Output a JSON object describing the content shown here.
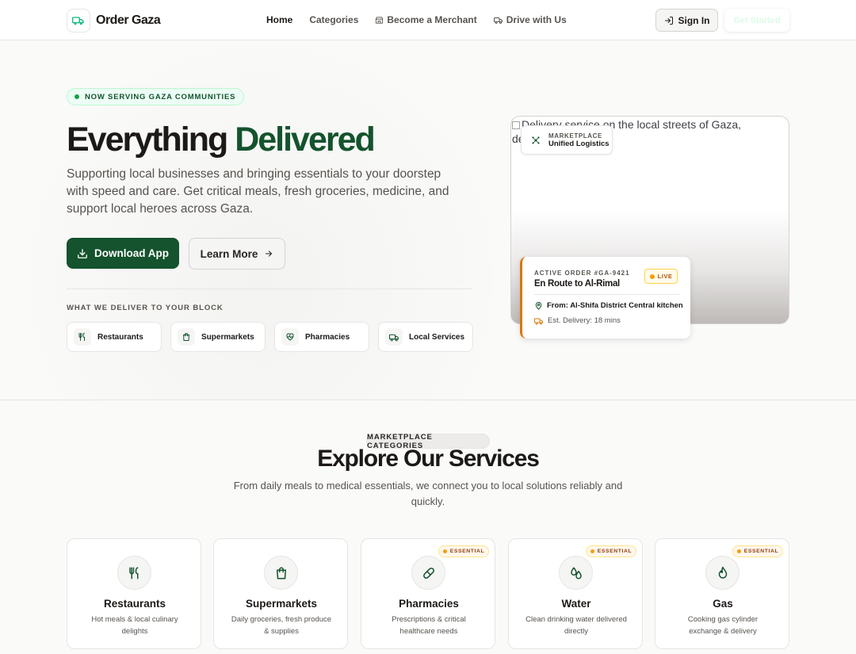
{
  "nav": {
    "logo_text": "Order Gaza",
    "links": [
      "Home",
      "Categories",
      "Become a Merchant",
      "Drive with Us"
    ],
    "sign_in": "Sign In",
    "get_started": "Get Started"
  },
  "hero": {
    "badge": "NOW SERVING GAZA COMMUNITIES",
    "title_part1": "Everything",
    "title_part2": "Delivered",
    "description": "Supporting local businesses and bringing essentials to your doorstep with speed and care. Get critical meals, fresh groceries, medicine, and support local heroes across Gaza.",
    "download_btn": "Download App",
    "learn_btn": "Learn More",
    "deliver_label": "WHAT WE DELIVER TO YOUR BLOCK",
    "chips": [
      "Restaurants",
      "Supermarkets",
      "Pharmacies",
      "Local Services"
    ],
    "image_alt": "Delivery service on the local streets of Gaza, delivering hot meals",
    "marketplace": {
      "label": "MARKETPLACE",
      "value": "Unified Logistics"
    },
    "order": {
      "id_label": "ACTIVE ORDER #GA-9421",
      "title": "En Route to Al-Rimal",
      "status": "LIVE",
      "from": "From: Al-Shifa District Central kitchen",
      "eta": "Est. Delivery: 18 mins"
    }
  },
  "services": {
    "badge": "MARKETPLACE CATEGORIES",
    "title": "Explore Our Services",
    "description": "From daily meals to medical essentials, we connect you to local solutions reliably and quickly.",
    "essential_label": "ESSENTIAL",
    "cards": [
      {
        "name": "Restaurants",
        "desc": "Hot meals & local culinary delights",
        "icon": "utensils-icon"
      },
      {
        "name": "Supermarkets",
        "desc": "Daily groceries, fresh produce & supplies",
        "icon": "shopping-bag-icon"
      },
      {
        "name": "Pharmacies",
        "desc": "Prescriptions & critical healthcare needs",
        "icon": "pill-icon"
      },
      {
        "name": "Water",
        "desc": "Clean drinking water delivered directly",
        "icon": "droplets-icon"
      },
      {
        "name": "Gas",
        "desc": "Cooking gas cylinder exchange & delivery",
        "icon": "flame-icon"
      }
    ]
  },
  "colors": {
    "brand": "#14532d",
    "accent_amber": "#d97706",
    "text": "#1c1917",
    "muted": "#57534e"
  }
}
